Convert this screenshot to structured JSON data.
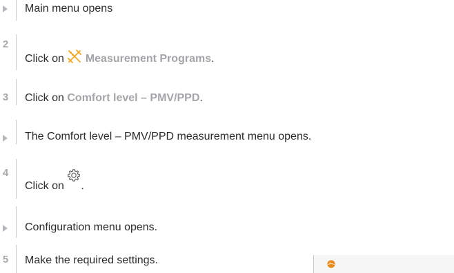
{
  "steps": [
    {
      "marker": "",
      "kind": "result",
      "text": "Main menu opens"
    },
    {
      "marker": "2",
      "kind": "action",
      "prefix": "Click on ",
      "highlight": "Measurement Programs",
      "suffix": ".",
      "icon": "measurement-programs-icon"
    },
    {
      "marker": "3",
      "kind": "action",
      "prefix": "Click on ",
      "highlight": "Comfort level – PMV/PPD",
      "suffix": "."
    },
    {
      "marker": "",
      "kind": "result",
      "text": "The Comfort level – PMV/PPD measurement menu opens."
    },
    {
      "marker": "4",
      "kind": "action",
      "prefix": "Click on ",
      "suffix": ".",
      "icon": "settings-gear-icon"
    },
    {
      "marker": "",
      "kind": "result",
      "text": "Configuration menu opens."
    },
    {
      "marker": "5",
      "kind": "action",
      "text": "Make the required settings."
    }
  ],
  "footer": {
    "logo_icon": "testo-logo-icon"
  },
  "colors": {
    "highlight_text": "#a3a5a8",
    "marker_grey": "#a7a9ac",
    "icon_orange": "#f5a623",
    "logo_orange": "#e8891c"
  }
}
